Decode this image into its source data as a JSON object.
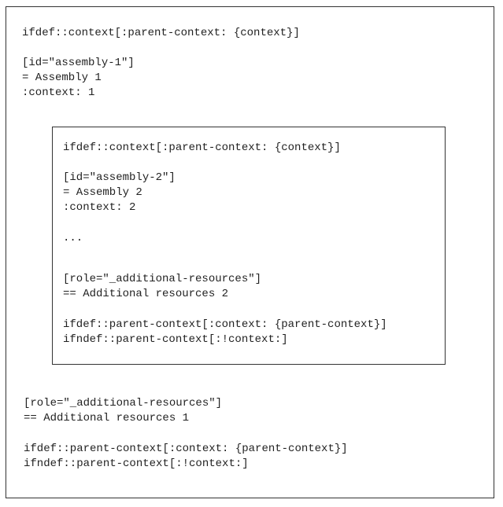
{
  "outer": {
    "lines": [
      "ifdef::context[:parent-context: {context}]",
      "[id=\"assembly-1\"]",
      "= Assembly 1",
      ":context: 1",
      "[role=\"_additional-resources\"]",
      "== Additional resources 1",
      "ifdef::parent-context[:context: {parent-context}]",
      "ifndef::parent-context[:!context:]"
    ]
  },
  "inner": {
    "lines": [
      "ifdef::context[:parent-context: {context}]",
      "[id=\"assembly-2\"]",
      "= Assembly 2",
      ":context: 2",
      "...",
      "[role=\"_additional-resources\"]",
      "== Additional resources 2",
      "ifdef::parent-context[:context: {parent-context}]",
      "ifndef::parent-context[:!context:]"
    ]
  }
}
